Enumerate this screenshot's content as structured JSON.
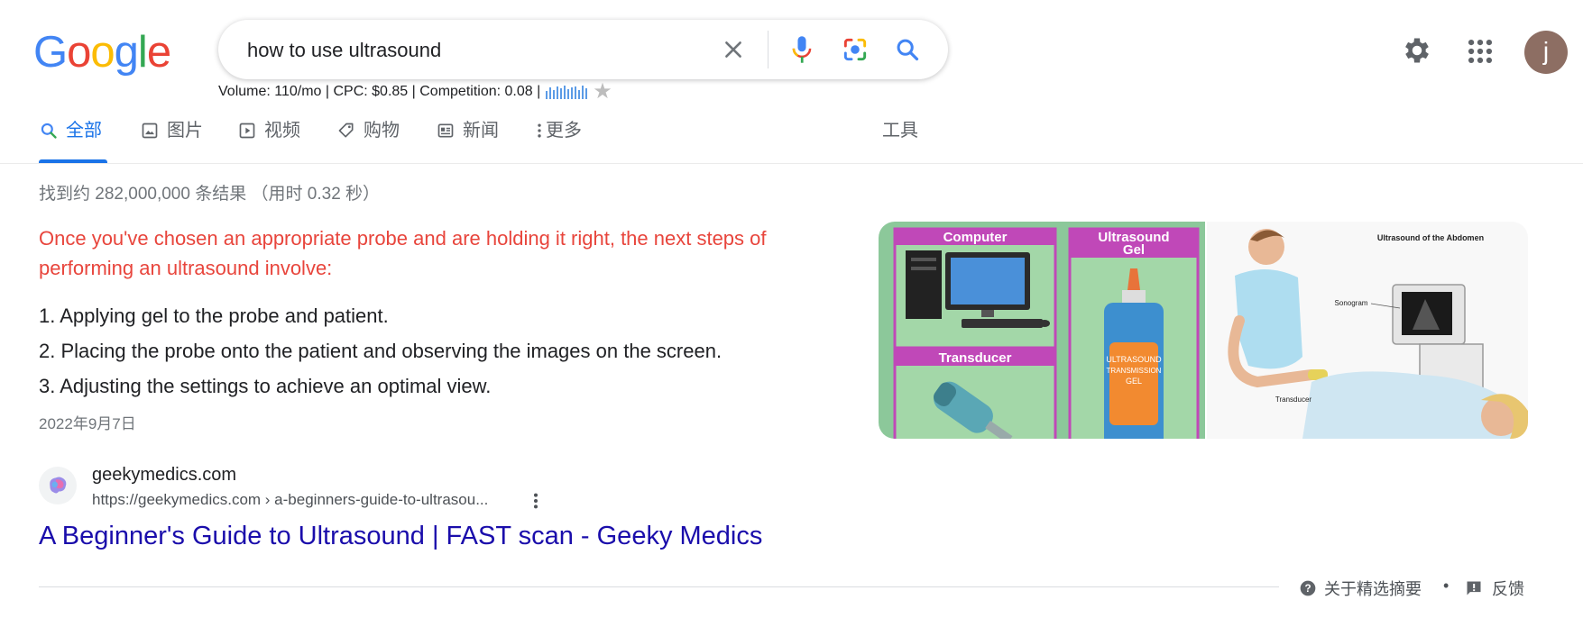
{
  "logo": {
    "letters": [
      "G",
      "o",
      "o",
      "g",
      "l",
      "e"
    ],
    "colors": [
      "#4285f4",
      "#ea4335",
      "#fbbc05",
      "#4285f4",
      "#34a853",
      "#ea4335"
    ]
  },
  "search": {
    "value": "how to use ultrasound"
  },
  "icons": {
    "clear": "close-icon",
    "mic": "mic-icon",
    "lens": "camera-lens-icon",
    "search": "search-icon",
    "settings": "gear-icon",
    "apps": "apps-grid-icon"
  },
  "keyword_stats": {
    "text": "Volume: 110/mo | CPC: $0.85 | Competition: 0.08 |",
    "trend_bars": [
      9,
      13,
      10,
      14,
      12,
      15,
      11,
      13,
      14,
      10,
      15,
      12
    ]
  },
  "account": {
    "initial": "j",
    "color": "#8d6e63"
  },
  "tabs": [
    {
      "label": "全部",
      "icon": "search-icon",
      "active": true
    },
    {
      "label": "图片",
      "icon": "image-icon"
    },
    {
      "label": "视频",
      "icon": "video-icon"
    },
    {
      "label": "购物",
      "icon": "tag-icon"
    },
    {
      "label": "新闻",
      "icon": "news-icon"
    },
    {
      "label": "更多",
      "icon": "more-vert-icon"
    }
  ],
  "tools_label": "工具",
  "result_stats": "找到约 282,000,000 条结果 （用时 0.32 秒）",
  "snippet": {
    "heading": "Once you've chosen an appropriate probe and are holding it right, the next steps of performing an ultrasound involve:",
    "steps": [
      "1. Applying gel to the probe and patient.",
      "2. Placing the probe onto the patient and observing the images on the screen.",
      "3. Adjusting the settings to achieve an optimal view."
    ],
    "date": "2022年9月7日",
    "image1": {
      "computer_label": "Computer",
      "gel_label_1": "Ultrasound",
      "gel_label_2": "Gel",
      "transducer_label": "Transducer",
      "bottle_text_1": "ULTRASOUND",
      "bottle_text_2": "TRANSMISSION",
      "bottle_text_3": "GEL"
    },
    "image2": {
      "title": "Ultrasound of the Abdomen",
      "sonogram": "Sonogram",
      "transducer": "Transducer"
    }
  },
  "result": {
    "site_name": "geekymedics.com",
    "url": "https://geekymedics.com › a-beginners-guide-to-ultrasou...",
    "title": "A Beginner's Guide to Ultrasound | FAST scan - Geeky Medics"
  },
  "footer": {
    "about": "关于精选摘要",
    "dot": "•",
    "feedback": "反馈"
  }
}
